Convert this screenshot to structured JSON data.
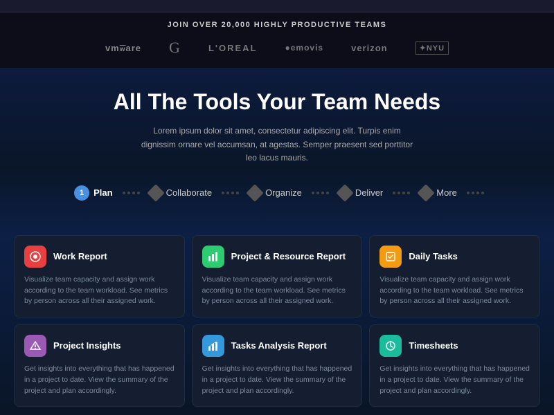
{
  "browser": {
    "bar_placeholder": ""
  },
  "logos_section": {
    "join_text": "JOIN OVER 20,000 HIGHLY PRODUCTIVE TEAMS",
    "logos": [
      {
        "id": "vmware",
        "text": "vmˍware",
        "class": "logo-vm"
      },
      {
        "id": "google",
        "text": "G",
        "class": "logo-google"
      },
      {
        "id": "loreal",
        "text": "L'OREAL",
        "class": "logo-loreal"
      },
      {
        "id": "emovis",
        "text": "●emovis",
        "class": "logo-emovis"
      },
      {
        "id": "verizon",
        "text": "verizon",
        "class": "logo-verizon"
      },
      {
        "id": "nyu",
        "text": "✦NYU",
        "class": "logo-nyu"
      }
    ]
  },
  "hero": {
    "title": "All The Tools Your Team Needs",
    "subtitle": "Lorem ipsum dolor sit amet, consectetur adipiscing elit. Turpis enim dignissim ornare vel accumsan, at agestas. Semper praesent sed porttitor leo lacus mauris."
  },
  "tabs": [
    {
      "id": "plan",
      "label": "Plan",
      "active": true,
      "type": "numbered",
      "number": "1"
    },
    {
      "id": "collaborate",
      "label": "Collaborate",
      "active": false,
      "type": "diamond"
    },
    {
      "id": "organize",
      "label": "Organize",
      "active": false,
      "type": "diamond"
    },
    {
      "id": "deliver",
      "label": "Deliver",
      "active": false,
      "type": "diamond"
    },
    {
      "id": "more",
      "label": "More",
      "active": false,
      "type": "diamond"
    }
  ],
  "cards": [
    {
      "id": "work-report",
      "title": "Work Report",
      "icon_emoji": "🎯",
      "icon_class": "icon-red",
      "description": "Visualize team capacity and assign work according to the team workload. See metrics by person across all their assigned work."
    },
    {
      "id": "project-resource",
      "title": "Project & Resource Report",
      "icon_emoji": "📊",
      "icon_class": "icon-green",
      "description": "Visualize team capacity and assign work according to the team workload. See metrics by person across all their assigned work."
    },
    {
      "id": "daily-tasks",
      "title": "Daily Tasks",
      "icon_emoji": "📋",
      "icon_class": "icon-orange",
      "description": "Visualize team capacity and assign work according to the team workload. See metrics by person across all their assigned work."
    },
    {
      "id": "project-insights",
      "title": "Project Insights",
      "icon_emoji": "💡",
      "icon_class": "icon-purple",
      "description": "Get insights into everything that has happened in a project to date. View the summary of the project and plan accordingly."
    },
    {
      "id": "tasks-analysis",
      "title": "Tasks Analysis Report",
      "icon_emoji": "📈",
      "icon_class": "icon-blue",
      "description": "Get insights into everything that has happened in a project to date. View the summary of the project and plan accordingly."
    },
    {
      "id": "timesheets",
      "title": "Timesheets",
      "icon_emoji": "⏱",
      "icon_class": "icon-teal",
      "description": "Get insights into everything that has happened in a project to date. View the summary of the project and plan accordingly."
    }
  ]
}
